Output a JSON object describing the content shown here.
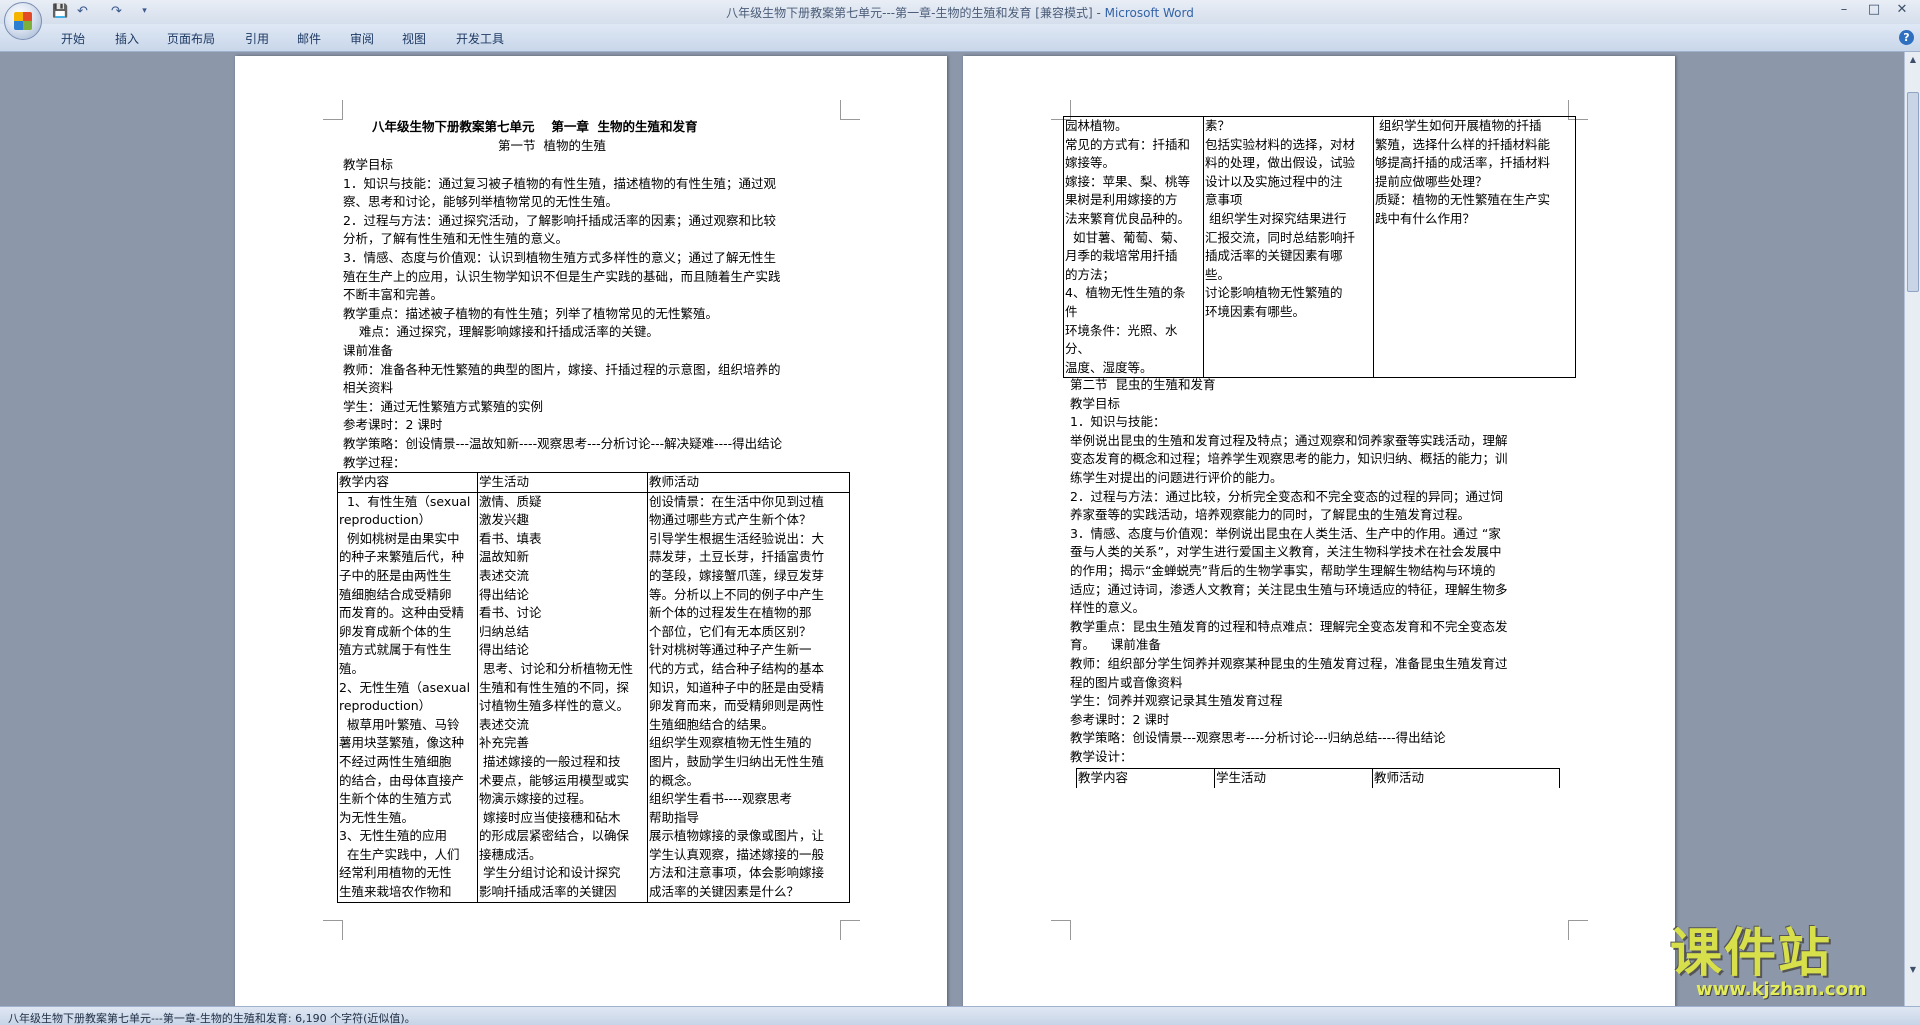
{
  "window": {
    "title": "八年级生物下册教案第七单元---第一章-生物的生殖和发育 [兼容模式] - ",
    "app_name": "Microsoft Word",
    "controls": {
      "minimize": "–",
      "maximize": "□",
      "close": "✕"
    }
  },
  "quick_access": {
    "save": "💾",
    "undo": "↶",
    "redo": "↷",
    "customize": "▾"
  },
  "ribbon": {
    "tabs": [
      "开始",
      "插入",
      "页面布局",
      "引用",
      "邮件",
      "审阅",
      "视图",
      "开发工具"
    ],
    "help": "?"
  },
  "page1": {
    "lines": [
      "教学目标",
      "1．知识与技能：通过复习被子植物的有性生殖，描述植物的有性生殖；通过观",
      "察、思考和讨论，能够列举植物常见的无性生殖。",
      "2．过程与方法：通过探究活动，了解影响扦插成活率的因素；通过观察和比较",
      "分析，了解有性生殖和无性生殖的意义。",
      "3．情感、态度与价值观：认识到植物生殖方式多样性的意义；通过了解无性生",
      "殖在生产上的应用，认识生物学知识不但是生产实践的基础，而且随着生产实践",
      "不断丰富和完善。",
      "教学重点：描述被子植物的有性生殖；列举了植物常见的无性繁殖。",
      "    难点：通过探究，理解影响嫁接和扦插成活率的关键。",
      "课前准备",
      "教师：准备各种无性繁殖的典型的图片，嫁接、扦插过程的示意图，组织培养的",
      "相关资料",
      "学生：通过无性繁殖方式繁殖的实例",
      "参考课时：2 课时",
      "教学策略：创设情景---温故知新----观察思考---分析讨论---解决疑难----得出结论",
      "教学过程："
    ],
    "title1": "八年级生物下册教案第七单元　 第一章  生物的生殖和发育",
    "title2": "第一节  植物的生殖",
    "table": {
      "headers": [
        "教学内容",
        "学生活动",
        "教师活动"
      ],
      "col1": "  1、有性生殖（sexual\nreproduction）\n  例如桃树是由果实中\n的种子来繁殖后代，种\n子中的胚是由两性生\n殖细胞结合成受精卵\n而发育的。这种由受精\n卵发育成新个体的生\n殖方式就属于有性生\n殖。\n2、无性生殖（asexual\nreproduction）\n  椒草用叶繁殖、马铃\n薯用块茎繁殖，像这种\n不经过两性生殖细胞\n的结合，由母体直接产\n生新个体的生殖方式\n为无性生殖。\n3、无性生殖的应用\n  在生产实践中，人们\n经常利用植物的无性\n生殖来栽培农作物和",
      "col2": "激情、质疑\n激发兴趣\n看书、填表\n温故知新\n表述交流\n得出结论\n看书、讨论\n归纳总结\n得出结论\n 思考、讨论和分析植物无性\n生殖和有性生殖的不同，探\n讨植物生殖多样性的意义。\n表述交流\n补充完善\n 描述嫁接的一般过程和技\n术要点，能够运用模型或实\n物演示嫁接的过程。\n 嫁接时应当使接穗和砧木\n的形成层紧密结合，以确保\n接穗成活。\n 学生分组讨论和设计探究\n影响扦插成活率的关键因",
      "col3": "创设情景：在生活中你见到过植\n物通过哪些方式产生新个体？\n引导学生根据生活经验说出：大\n蒜发芽，土豆长芽，扦插富贵竹\n的茎段，嫁接蟹爪莲，绿豆发芽\n等。分析以上不同的例子中产生\n新个体的过程发生在植物的那\n个部位，它们有无本质区别？\n针对桃树等通过种子产生新一\n代的方式，结合种子结构的基本\n知识，知道种子中的胚是由受精\n卵发育而来，而受精卵则是两性\n生殖细胞结合的结果。\n组织学生观察植物无性生殖的\n图片，鼓励学生归纳出无性生殖\n的概念。\n组织学生看书----观察思考\n帮助指导\n展示植物嫁接的录像或图片，让\n学生认真观察，描述嫁接的一般\n方法和注意事项，体会影响嫁接\n成活率的关键因素是什么？"
    }
  },
  "page2": {
    "table_top": {
      "col1": "园林植物。\n常见的方式有：扦插和\n嫁接等。\n嫁接：苹果、梨、桃等\n果树是利用嫁接的方\n法来繁育优良品种的。\n  如甘薯、葡萄、菊、\n月季的栽培常用扦插\n的方法；\n4、植物无性生殖的条\n件\n环境条件：光照、水分、\n温度、湿度等。",
      "col2": "素？\n包括实验材料的选择，对材\n料的处理，做出假设，试验\n设计以及实施过程中的注\n意事项\n 组织学生对探究结果进行\n汇报交流，同时总结影响扦\n插成活率的关键因素有哪\n些。\n讨论影响植物无性繁殖的\n环境因素有哪些。",
      "col3": " 组织学生如何开展植物的扦插\n繁殖，选择什么样的扦插材料能\n够提高扦插的成活率，扦插材料\n提前应做哪些处理？\n质疑：植物的无性繁殖在生产实\n践中有什么作用？"
    },
    "lines": [
      "第二节  昆虫的生殖和发育",
      "教学目标",
      "1．知识与技能：",
      "举例说出昆虫的生殖和发育过程及特点；通过观察和饲养家蚕等实践活动，理解",
      "变态发育的概念和过程；培养学生观察思考的能力，知识归纳、概括的能力；训",
      "练学生对提出的问题进行评价的能力。",
      "2．过程与方法：通过比较，分析完全变态和不完全变态的过程的异同；通过饲",
      "养家蚕等的实践活动，培养观察能力的同时，了解昆虫的生殖发育过程。",
      "3．情感、态度与价值观：举例说出昆虫在人类生活、生产中的作用。通过 “家",
      "蚕与人类的关系”，对学生进行爱国主义教育，关注生物科学技术在社会发展中",
      "的作用；揭示“金蝉蜕壳”背后的生物学事实，帮助学生理解生物结构与环境的",
      "适应；通过诗词，渗透人文教育；关注昆虫生殖与环境适应的特征，理解生物多",
      "样性的意义。",
      "教学重点：昆虫生殖发育的过程和特点难点：理解完全变态发育和不完全变态发",
      "育。    课前准备",
      "教师：组织部分学生饲养并观察某种昆虫的生殖发育过程，准备昆虫生殖发育过",
      "程的图片或音像资料",
      "学生：饲养并观察记录其生殖发育过程",
      "参考课时：2 课时",
      "教学策略：创设情景---观察思考----分析讨论---归纳总结----得出结论",
      "教学设计："
    ],
    "table_bottom": {
      "headers": [
        "教学内容",
        "学生活动",
        "教师活动"
      ]
    }
  },
  "status": {
    "text": "八年级生物下册教案第七单元---第一章-生物的生殖和发育: 6,190 个字符(近似值)。"
  },
  "watermark": {
    "brand": "课件站",
    "url": "www.kjzhan.com"
  }
}
